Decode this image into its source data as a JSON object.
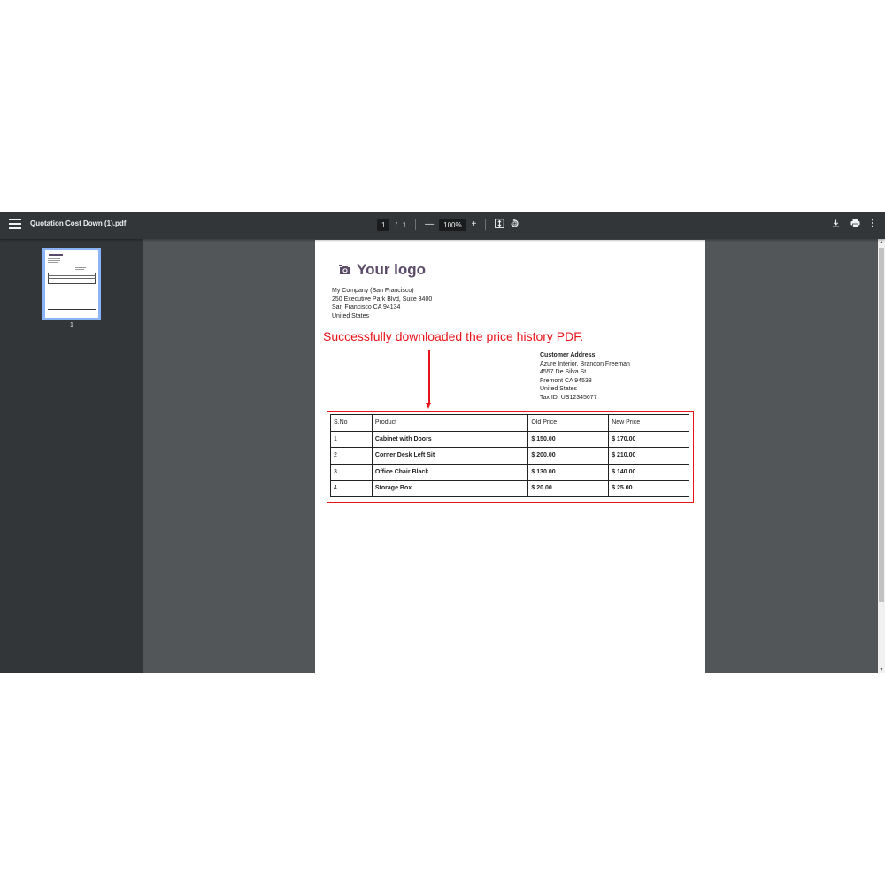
{
  "toolbar": {
    "title": "Quotation Cost Down (1).pdf",
    "page_current": "1",
    "page_separator": "/",
    "page_total": "1",
    "zoom": "100%",
    "zoom_out": "—",
    "zoom_in": "+"
  },
  "sidebar": {
    "thumb_page_number": "1"
  },
  "document": {
    "logo_text": "Your logo",
    "company_lines": [
      "My Company (San Francisco)",
      "250 Executive Park Blvd, Suite 3400",
      "San Francisco CA 94134",
      "United States"
    ],
    "annotation": "Successfully downloaded the price history PDF.",
    "customer": {
      "heading": "Customer Address",
      "lines": [
        "Azure Interior, Brandon Freeman",
        "4557 De Silva St",
        "Fremont CA 94538",
        "United States",
        "Tax ID: US12345677"
      ]
    },
    "table": {
      "headers": [
        "S.No",
        "Product",
        "Old Price",
        "New Price"
      ],
      "rows": [
        [
          "1",
          "Cabinet with Doors",
          "$ 150.00",
          "$ 170.00"
        ],
        [
          "2",
          "Corner Desk Left Sit",
          "$ 200.00",
          "$ 210.00"
        ],
        [
          "3",
          "Office Chair Black",
          "$ 130.00",
          "$ 140.00"
        ],
        [
          "4",
          "Storage Box",
          "$ 20.00",
          "$ 25.00"
        ]
      ]
    }
  },
  "colors": {
    "toolbar_bg": "#323639",
    "viewer_bg": "#525659",
    "annotation_red": "#e8141b",
    "logo_purple": "#5b4a68",
    "thumb_border": "#8ab4f8"
  }
}
